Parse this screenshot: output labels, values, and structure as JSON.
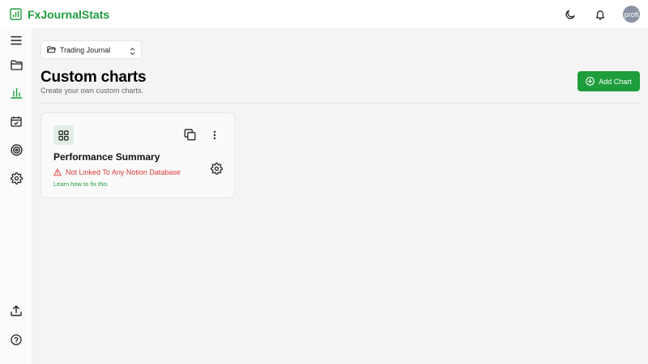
{
  "app": {
    "name": "FxJournalStats",
    "brand_color": "#1e9d3d"
  },
  "header": {
    "theme_icon": "moon-icon",
    "notifications_icon": "bell-icon",
    "avatar_text": "profi"
  },
  "sidebar": {
    "items": [
      {
        "icon": "menu-icon"
      },
      {
        "icon": "folder-icon"
      },
      {
        "icon": "bar-chart-icon",
        "active": true
      },
      {
        "icon": "calendar-check-icon"
      },
      {
        "icon": "target-icon"
      },
      {
        "icon": "gear-icon"
      }
    ],
    "bottom_items": [
      {
        "icon": "upload-icon"
      },
      {
        "icon": "help-icon"
      }
    ]
  },
  "journal_selector": {
    "value": "Trading Journal"
  },
  "page": {
    "title": "Custom charts",
    "subtitle": "Create your own custom charts."
  },
  "add_chart_button": {
    "label": "Add Chart"
  },
  "cards": [
    {
      "title": "Performance Summary",
      "warning": "Not Linked To Any Notion Database",
      "link": "Learn how to fix this",
      "warning_color": "#dc3b3b"
    }
  ]
}
